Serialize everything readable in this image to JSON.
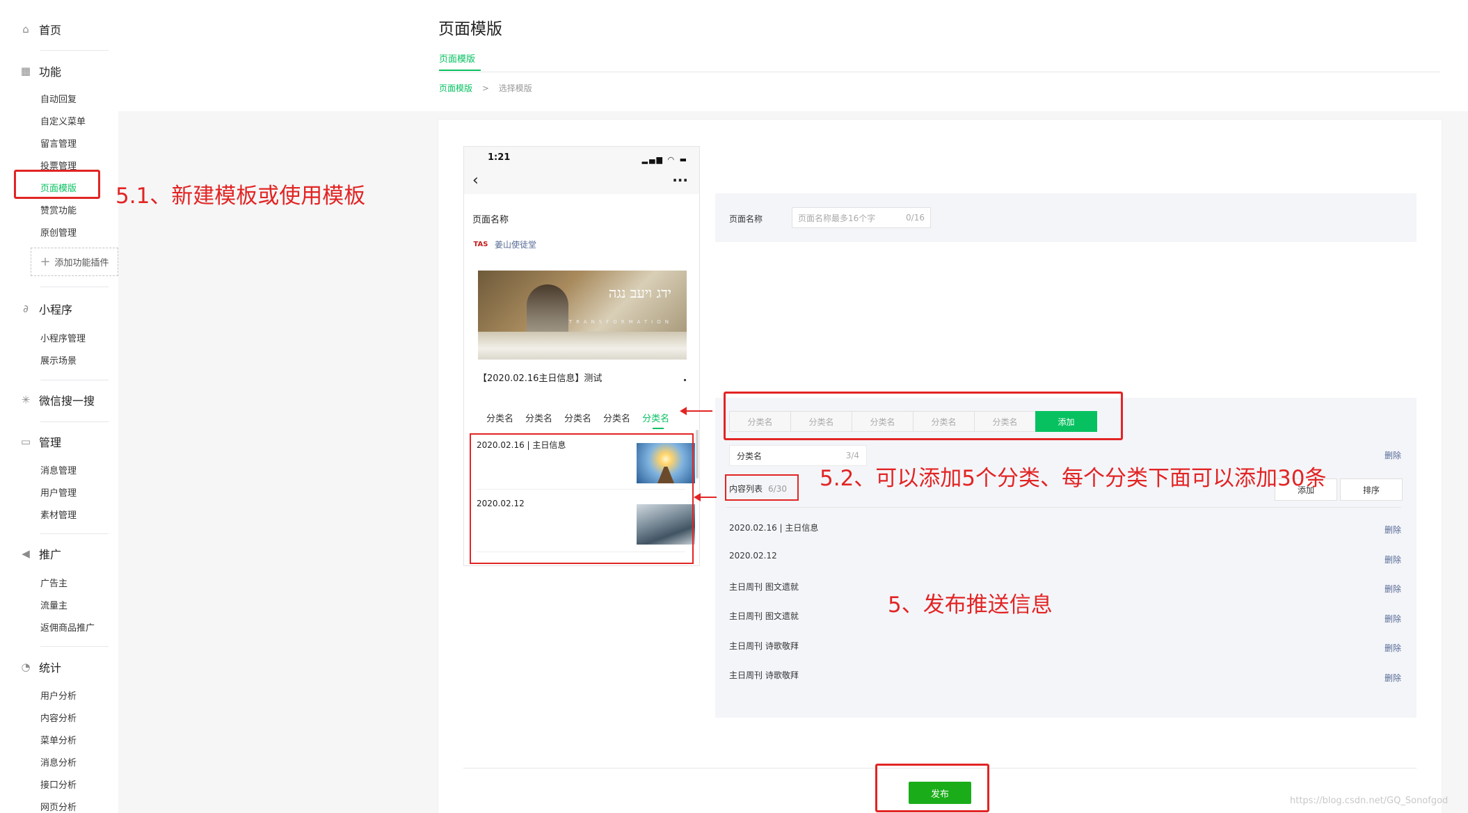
{
  "sidebar": {
    "home": "首页",
    "function": {
      "title": "功能",
      "items": [
        "自动回复",
        "自定义菜单",
        "留言管理",
        "投票管理",
        "页面模版",
        "赞赏功能",
        "原创管理"
      ],
      "add_plugin": "添加功能插件"
    },
    "miniprogram": {
      "title": "小程序",
      "items": [
        "小程序管理",
        "展示场景"
      ]
    },
    "search": {
      "title": "微信搜一搜"
    },
    "manage": {
      "title": "管理",
      "items": [
        "消息管理",
        "用户管理",
        "素材管理"
      ]
    },
    "promote": {
      "title": "推广",
      "items": [
        "广告主",
        "流量主",
        "返佣商品推广"
      ]
    },
    "stats": {
      "title": "统计",
      "items": [
        "用户分析",
        "内容分析",
        "菜单分析",
        "消息分析",
        "接口分析",
        "网页分析"
      ]
    }
  },
  "header": {
    "title": "页面模版",
    "tab": "页面模版",
    "breadcrumb": {
      "link": "页面模版",
      "sep": ">",
      "current": "选择模版"
    }
  },
  "phone": {
    "time": "1:21",
    "status_icons": "▂▄▆ ◠ ▬",
    "back": "‹",
    "more": "···",
    "page_name": "页面名称",
    "author_logo": "TAS",
    "author": "姜山使徒堂",
    "banner_text": "ידג ויעב נגה",
    "banner_small": "TRANSFORMATION",
    "article_title": "【2020.02.16主日信息】测试",
    "categories": [
      "分类名",
      "分类名",
      "分类名",
      "分类名",
      "分类名"
    ],
    "list": [
      "2020.02.16 | 主日信息",
      "2020.02.12"
    ]
  },
  "form": {
    "page_name_label": "页面名称",
    "page_name_placeholder": "页面名称最多16个字",
    "page_name_count": "0/16",
    "category_tabs": [
      "分类名",
      "分类名",
      "分类名",
      "分类名",
      "分类名"
    ],
    "add_category": "添加",
    "category_input": "分类名",
    "category_count": "3/4",
    "delete": "删除",
    "content_list_label": "内容列表",
    "content_list_count": "6/30",
    "add_button": "添加",
    "sort_button": "排序",
    "rows": [
      "2020.02.16 | 主日信息",
      "2020.02.12",
      "主日周刊 图文遗就",
      "主日周刊 图文遗就",
      "主日周刊 诗歌敬拜",
      "主日周刊 诗歌敬拜"
    ],
    "publish": "发布"
  },
  "annotations": {
    "a51": "5.1、新建模板或使用模板",
    "a52": "5.2、可以添加5个分类、每个分类下面可以添加30条",
    "a5": "5、发布推送信息"
  },
  "watermark": "https://blog.csdn.net/GQ_Sonofgod",
  "colors": {
    "accent": "#07c160",
    "annotation": "#e22424",
    "link": "#576b95"
  }
}
